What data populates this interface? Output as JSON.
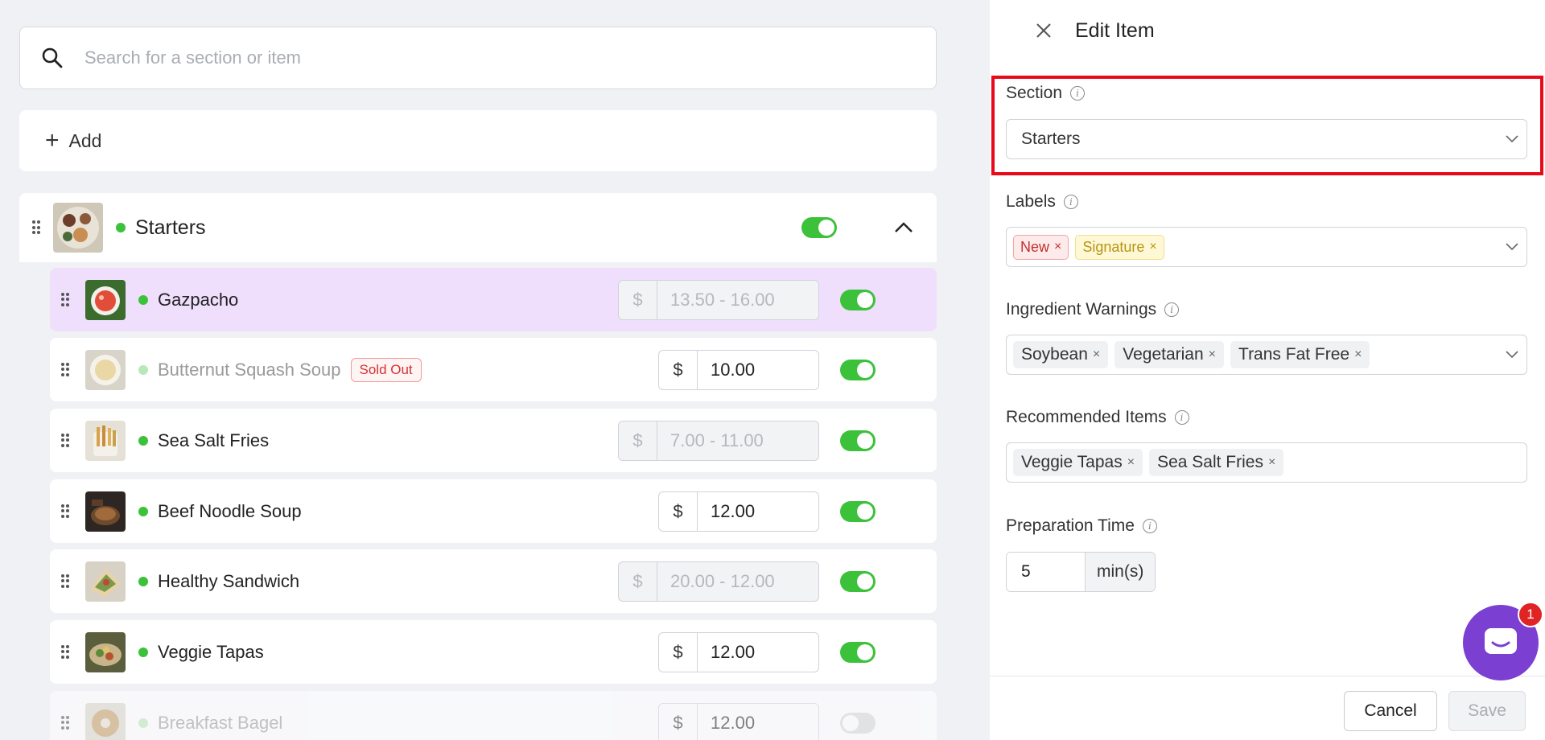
{
  "search": {
    "placeholder": "Search for a section or item"
  },
  "add": {
    "label": "Add"
  },
  "section": {
    "title": "Starters",
    "enabled": true
  },
  "items": [
    {
      "name": "Gazpacho",
      "price": "13.50 - 16.00",
      "range": true,
      "sold_out": false,
      "enabled": true,
      "selected": true
    },
    {
      "name": "Butternut Squash Soup",
      "price": "10.00",
      "range": false,
      "sold_out": true,
      "badge": "Sold Out",
      "enabled": true
    },
    {
      "name": "Sea Salt Fries",
      "price": "7.00 - 11.00",
      "range": true,
      "enabled": true
    },
    {
      "name": "Beef Noodle Soup",
      "price": "12.00",
      "range": false,
      "enabled": true
    },
    {
      "name": "Healthy Sandwich",
      "price": "20.00 - 12.00",
      "range": true,
      "enabled": true
    },
    {
      "name": "Veggie Tapas",
      "price": "12.00",
      "range": false,
      "enabled": true
    },
    {
      "name": "Breakfast Bagel",
      "price": "12.00",
      "range": false,
      "enabled": false
    }
  ],
  "currency_symbol": "$",
  "panel": {
    "title": "Edit Item",
    "section_label": "Section",
    "section_value": "Starters",
    "labels_label": "Labels",
    "labels": [
      "New",
      "Signature"
    ],
    "warnings_label": "Ingredient Warnings",
    "warnings": [
      "Soybean",
      "Vegetarian",
      "Trans Fat Free"
    ],
    "recommended_label": "Recommended Items",
    "recommended": [
      "Veggie Tapas",
      "Sea Salt Fries"
    ],
    "prep_label": "Preparation Time",
    "prep_value": "5",
    "prep_unit": "min(s)",
    "cancel": "Cancel",
    "save": "Save"
  },
  "chat": {
    "unread": "1"
  },
  "colors": {
    "accent_green": "#3cc13b",
    "highlight_red": "#e8091b",
    "chat_purple": "#7b3fd1",
    "selected_row": "#efdffd"
  }
}
